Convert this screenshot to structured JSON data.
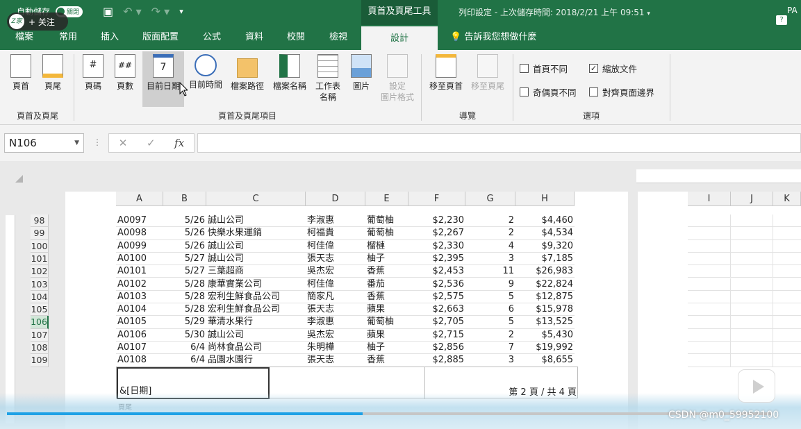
{
  "titlebar": {
    "autosave_label": "自動儲存",
    "autosave_state": "關閉",
    "context_tool": "頁首及頁尾工具",
    "doc_title": "列印設定 - 上次儲存時間: 2018/2/21 上午 09:51",
    "user": "PA",
    "help": "?"
  },
  "overlay": {
    "follow_label": "+ 关注",
    "logo_text": "Z家",
    "watermark": "CSDN @m0_59952100"
  },
  "tabs": {
    "file": "檔案",
    "home": "常用",
    "insert": "插入",
    "layout": "版面配置",
    "formulas": "公式",
    "data": "資料",
    "review": "校閱",
    "view": "檢視",
    "design": "設計",
    "tell_me": "告訴我您想做什麼"
  },
  "ribbon": {
    "header": "頁首",
    "footer": "頁尾",
    "page_number": "頁碼",
    "page_count": "頁數",
    "current_date": "目前日期",
    "current_time": "目前時間",
    "file_path": "檔案路徑",
    "file_name": "檔案名稱",
    "sheet_name_1": "工作表",
    "sheet_name_2": "名稱",
    "picture": "圖片",
    "format_picture_1": "設定",
    "format_picture_2": "圖片格式",
    "goto_header": "移至頁首",
    "goto_footer": "移至頁尾",
    "group_hf": "頁首及頁尾",
    "group_elements": "頁首及頁尾項目",
    "group_nav": "導覽",
    "group_options": "選項",
    "opt_first_page": "首頁不同",
    "opt_odd_even": "奇偶頁不同",
    "opt_scale": "縮放文件",
    "opt_align": "對齊頁面邊界",
    "opt_scale_checked": "✓"
  },
  "formula_bar": {
    "name_box": "N106",
    "cancel": "✕",
    "enter": "✓",
    "fx": "fx"
  },
  "sheet": {
    "columns": [
      "A",
      "B",
      "C",
      "D",
      "E",
      "F",
      "G",
      "H"
    ],
    "columns_right": [
      "I",
      "J",
      "K"
    ],
    "rows": [
      {
        "n": "98",
        "a": "A0097",
        "b": "5/26",
        "c": "誠山公司",
        "d": "李淑惠",
        "e": "葡萄柚",
        "f": "$2,230",
        "g": "2",
        "h": "$4,460"
      },
      {
        "n": "99",
        "a": "A0098",
        "b": "5/26",
        "c": "快樂水果運銷",
        "d": "柯福貴",
        "e": "葡萄柚",
        "f": "$2,267",
        "g": "2",
        "h": "$4,534"
      },
      {
        "n": "100",
        "a": "A0099",
        "b": "5/26",
        "c": "誠山公司",
        "d": "柯佳偉",
        "e": "榴槤",
        "f": "$2,330",
        "g": "4",
        "h": "$9,320"
      },
      {
        "n": "101",
        "a": "A0100",
        "b": "5/27",
        "c": "誠山公司",
        "d": "張天志",
        "e": "柚子",
        "f": "$2,395",
        "g": "3",
        "h": "$7,185"
      },
      {
        "n": "102",
        "a": "A0101",
        "b": "5/27",
        "c": "三葉超商",
        "d": "吳杰宏",
        "e": "香蕉",
        "f": "$2,453",
        "g": "11",
        "h": "$26,983"
      },
      {
        "n": "103",
        "a": "A0102",
        "b": "5/28",
        "c": "康華實業公司",
        "d": "柯佳偉",
        "e": "番茄",
        "f": "$2,536",
        "g": "9",
        "h": "$22,824"
      },
      {
        "n": "104",
        "a": "A0103",
        "b": "5/28",
        "c": "宏利生鮮食品公司",
        "d": "簡家凡",
        "e": "香蕉",
        "f": "$2,575",
        "g": "5",
        "h": "$12,875"
      },
      {
        "n": "105",
        "a": "A0104",
        "b": "5/28",
        "c": "宏利生鮮食品公司",
        "d": "張天志",
        "e": "蘋果",
        "f": "$2,663",
        "g": "6",
        "h": "$15,978"
      },
      {
        "n": "106",
        "a": "A0105",
        "b": "5/29",
        "c": "華清水果行",
        "d": "李淑惠",
        "e": "葡萄柚",
        "f": "$2,705",
        "g": "5",
        "h": "$13,525"
      },
      {
        "n": "107",
        "a": "A0106",
        "b": "5/30",
        "c": "誠山公司",
        "d": "吳杰宏",
        "e": "蘋果",
        "f": "$2,715",
        "g": "2",
        "h": "$5,430"
      },
      {
        "n": "108",
        "a": "A0107",
        "b": "6/4",
        "c": "尚林食品公司",
        "d": "朱明樺",
        "e": "柚子",
        "f": "$2,856",
        "g": "7",
        "h": "$19,992"
      },
      {
        "n": "109",
        "a": "A0108",
        "b": "6/4",
        "c": "品園水園行",
        "d": "張天志",
        "e": "香蕉",
        "f": "$2,885",
        "g": "3",
        "h": "$8,655"
      }
    ],
    "footer_left": "&[日期]",
    "footer_right": "第 2 頁 / 共 4 頁",
    "footer_label": "頁尾"
  },
  "video": {
    "progress": 0.465
  }
}
